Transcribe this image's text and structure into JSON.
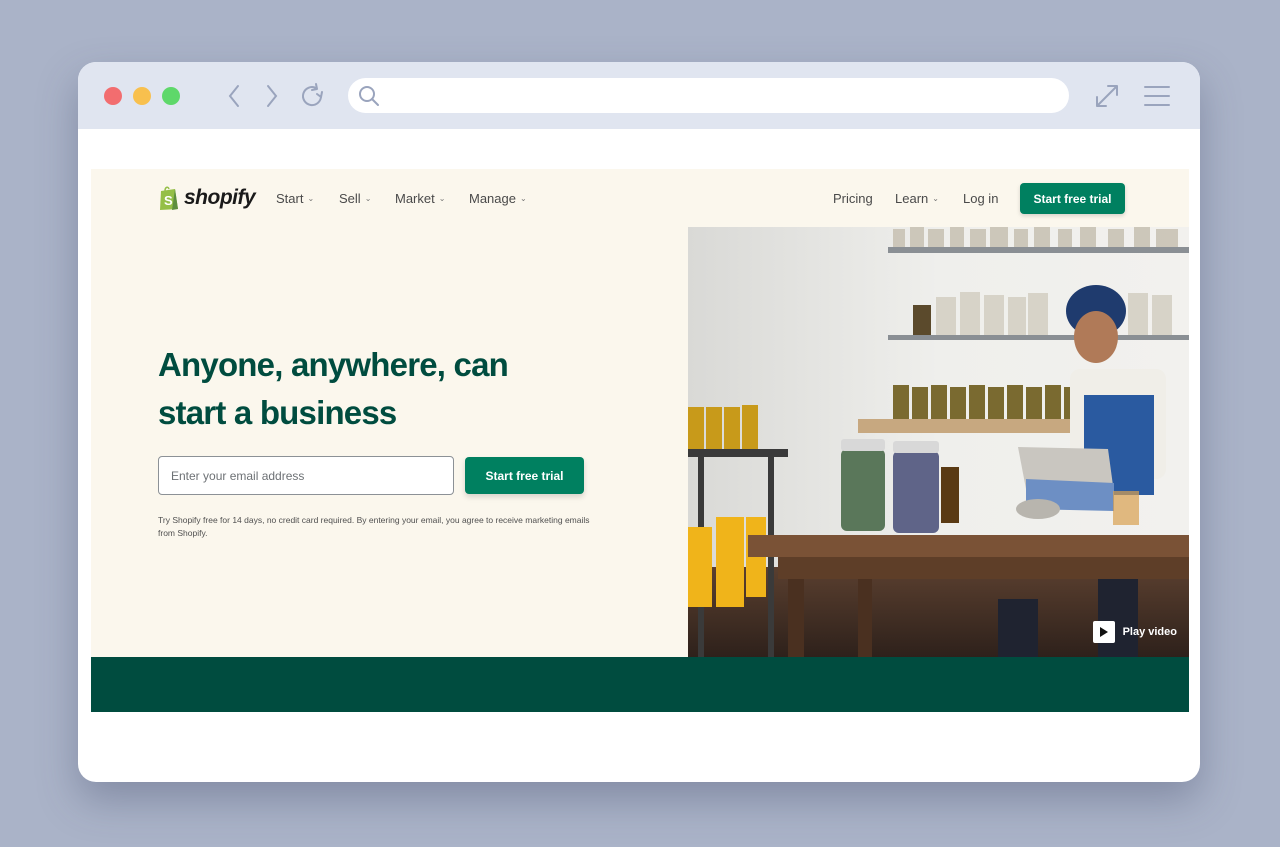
{
  "browser": {
    "url_value": "",
    "url_placeholder": ""
  },
  "site": {
    "brand": "shopify",
    "nav_left": [
      {
        "label": "Start",
        "has_dropdown": true
      },
      {
        "label": "Sell",
        "has_dropdown": true
      },
      {
        "label": "Market",
        "has_dropdown": true
      },
      {
        "label": "Manage",
        "has_dropdown": true
      }
    ],
    "nav_right": [
      {
        "label": "Pricing",
        "has_dropdown": false
      },
      {
        "label": "Learn",
        "has_dropdown": true
      },
      {
        "label": "Log in",
        "has_dropdown": false
      }
    ],
    "nav_cta": "Start free trial",
    "hero": {
      "headline_line1": "Anyone, anywhere, can",
      "headline_line2": "start a business",
      "email_placeholder": "Enter your email address",
      "email_value": "",
      "cta": "Start free trial",
      "disclaimer": "Try Shopify free for 14 days, no credit card required. By entering your email, you agree to receive marketing emails from Shopify.",
      "image_alt": "Woman working on a tablet at a wooden table surrounded by jars of herbs",
      "play_video": "Play video"
    }
  },
  "colors": {
    "brand_green": "#008060",
    "dark_green": "#004c3f",
    "page_bg": "#fbf7ed",
    "desktop_bg": "#aab3c8",
    "chrome_bg": "#e0e5f0"
  }
}
